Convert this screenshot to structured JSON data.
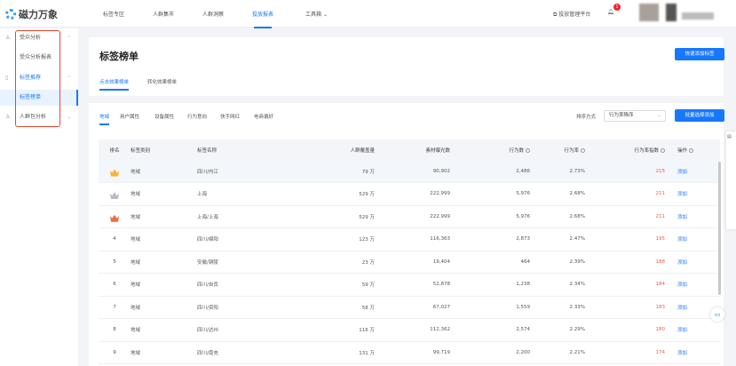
{
  "header": {
    "logo": "磁力万象",
    "nav": [
      "标签专区",
      "人群集市",
      "人群洞察",
      "投放报表",
      "工具箱"
    ],
    "active_nav": 3,
    "platform_link": "投放管理平台",
    "notif_count": "1"
  },
  "sidebar": {
    "items": [
      {
        "label": "受众分析",
        "icon": "user-icon",
        "chevron": "up"
      },
      {
        "label": "受众分析报表"
      },
      {
        "label": "标签推荐",
        "icon": "book-icon",
        "chevron": "up"
      },
      {
        "label": "标签榜单"
      },
      {
        "label": "人群包分析",
        "icon": "group-icon",
        "chevron": "down"
      }
    ]
  },
  "page": {
    "title": "标签榜单",
    "quick_add": "快速添加标签",
    "tabs": [
      "点击效果榜单",
      "转化效果榜单"
    ],
    "category_tabs": [
      "地域",
      "用户属性",
      "设备属性",
      "行为意向",
      "快手网红",
      "电商偏好"
    ],
    "sort_label": "排序方式",
    "sort_value": "行为率降序",
    "batch_add": "批量选择添加"
  },
  "table": {
    "headers": [
      "排名",
      "标签类别",
      "标签名称",
      "人群覆盖量",
      "素材曝光数",
      "行为数",
      "行为率",
      "行为率指数",
      "操作"
    ],
    "rows": [
      [
        "1",
        "地域",
        "四川/内江",
        "79 万",
        "90,902",
        "2,486",
        "2.73%",
        "215",
        "添加"
      ],
      [
        "2",
        "地域",
        "上海",
        "529 万",
        "222,999",
        "5,976",
        "2.68%",
        "211",
        "添加"
      ],
      [
        "3",
        "地域",
        "上海/上海",
        "529 万",
        "222,999",
        "5,976",
        "2.68%",
        "211",
        "添加"
      ],
      [
        "4",
        "地域",
        "四川/绵阳",
        "123 万",
        "116,363",
        "2,873",
        "2.47%",
        "195",
        "添加"
      ],
      [
        "5",
        "地域",
        "安徽/铜陵",
        "23 万",
        "19,404",
        "464",
        "2.39%",
        "188",
        "添加"
      ],
      [
        "6",
        "地域",
        "四川/自贡",
        "59 万",
        "52,878",
        "1,238",
        "2.34%",
        "184",
        "添加"
      ],
      [
        "7",
        "地域",
        "四川/资阳",
        "58 万",
        "67,027",
        "1,559",
        "2.33%",
        "183",
        "添加"
      ],
      [
        "8",
        "地域",
        "四川/达州",
        "116 万",
        "112,362",
        "2,574",
        "2.29%",
        "180",
        "添加"
      ],
      [
        "9",
        "地域",
        "四川/南充",
        "131 万",
        "99,719",
        "2,200",
        "2.21%",
        "174",
        "添加"
      ]
    ]
  },
  "colors": {
    "accent": "#1677ff",
    "gold": "#f7b52c",
    "silver": "#b8bcc6",
    "bronze": "#f26b3a",
    "index_red": "#f5584a"
  }
}
